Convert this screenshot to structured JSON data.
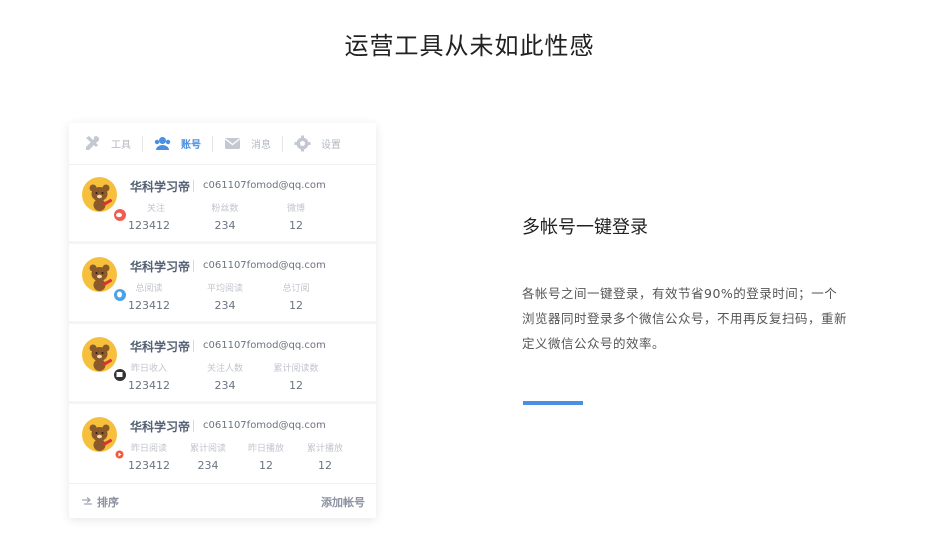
{
  "page": {
    "title": "运营工具从未如此性感"
  },
  "tabs": [
    {
      "label": "工具",
      "icon": "tools-icon",
      "active": false
    },
    {
      "label": "账号",
      "icon": "users-icon",
      "active": true
    },
    {
      "label": "消息",
      "icon": "message-icon",
      "active": false
    },
    {
      "label": "设置",
      "icon": "gear-icon",
      "active": false
    }
  ],
  "accounts": [
    {
      "name": "华科学习帝",
      "email": "c061107fomod@qq.com",
      "badge_color": "#ef5d52",
      "badge_icon": "weibo-icon",
      "labels": [
        "关注",
        "粉丝数",
        "微博"
      ],
      "values": [
        "123412",
        "234",
        "12"
      ]
    },
    {
      "name": "华科学习帝",
      "email": "c061107fomod@qq.com",
      "badge_color": "#4aa3e6",
      "badge_icon": "qq-icon",
      "labels": [
        "总阅读",
        "平均阅读",
        "总订阅"
      ],
      "values": [
        "123412",
        "234",
        "12"
      ]
    },
    {
      "name": "华科学习帝",
      "email": "c061107fomod@qq.com",
      "badge_color": "#333333",
      "badge_icon": "toutiao-icon",
      "labels": [
        "昨日收入",
        "关注人数",
        "累计阅读数"
      ],
      "values": [
        "123412",
        "234",
        "12"
      ]
    },
    {
      "name": "华科学习帝",
      "email": "c061107fomod@qq.com",
      "badge_color": "#ffffff",
      "badge_icon": "video-icon",
      "labels": [
        "昨日阅读",
        "累计阅读",
        "昨日播放",
        "累计播放"
      ],
      "values": [
        "123412",
        "234",
        "12",
        "12"
      ]
    }
  ],
  "footer": {
    "sort_label": "排序",
    "add_label": "添加帐号"
  },
  "feature": {
    "title": "多帐号一键登录",
    "description": "各帐号之间一键登录，有效节省90%的登录时间；一个浏览器同时登录多个微信公众号，不用再反复扫码，重新定义微信公众号的效率。",
    "accent_color": "#4a8fe0"
  }
}
